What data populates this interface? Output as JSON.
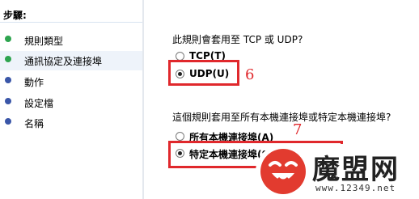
{
  "steps": {
    "header": "步驟:",
    "items": [
      {
        "label": "規則類型",
        "state": "done"
      },
      {
        "label": "通訊協定及連接埠",
        "state": "active"
      },
      {
        "label": "動作",
        "state": "todo"
      },
      {
        "label": "設定檔",
        "state": "todo"
      },
      {
        "label": "名稱",
        "state": "todo"
      }
    ]
  },
  "protocol": {
    "question": "此規則會套用至 TCP 或 UDP?",
    "tcp_label": "TCP(T)",
    "udp_label": "UDP(U)",
    "selected": "udp",
    "annotation": "6"
  },
  "ports": {
    "question": "這個規則套用至所有本機連接埠或特定本機連接埠?",
    "all_label": "所有本機連接埠(A)",
    "specific_label": "特定本機連接埠(S)",
    "selected": "specific",
    "annotation": "7"
  },
  "watermark": {
    "brand": "魔盟网",
    "site": "www.12349.net"
  },
  "colors": {
    "annotation_red": "#e0282c",
    "bullet_green": "#2ea44f",
    "bullet_blue": "#3a56a8"
  }
}
